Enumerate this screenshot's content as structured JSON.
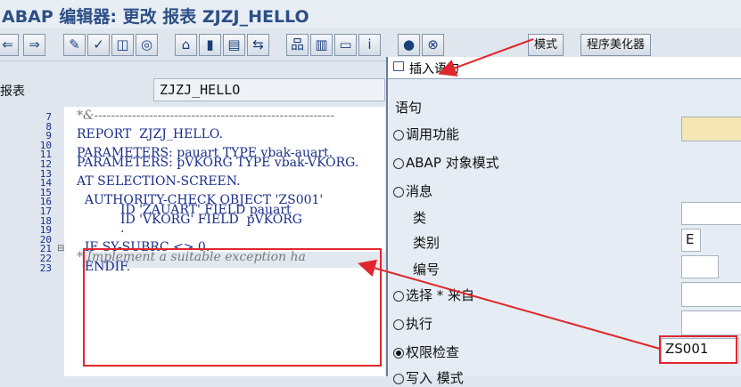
{
  "window": {
    "title": "ABAP 编辑器: 更改 报表 ZJZJ_HELLO"
  },
  "toolbar": {
    "icons": [
      "back-arrow-icon",
      "forward-arrow-icon",
      "other-object-icon",
      "check-icon",
      "activate-icon",
      "test-icon",
      "where-used-icon",
      "object-list-icon",
      "navigation-window-icon",
      "display-object-list-icon",
      "enhance-icon",
      "help-icon",
      "breakpoint-icon",
      "session-breakpoint-icon"
    ],
    "pattern_label": "模式",
    "pretty_printer_label": "程序美化器"
  },
  "editor": {
    "report_label": "报表",
    "report_name": "ZJZJ_HELLO",
    "lines": [
      {
        "no": "7",
        "text": "*&---------------------------------------------------------",
        "kind": "comment"
      },
      {
        "no": "8",
        "text": "",
        "kind": "code"
      },
      {
        "no": "9",
        "text": "REPORT  ZJZJ_HELLO.",
        "kind": "code"
      },
      {
        "no": "10",
        "text": "",
        "kind": "code"
      },
      {
        "no": "11",
        "text": "PARAMETERS: pauart TYPE vbak-auart.",
        "kind": "code"
      },
      {
        "no": "12",
        "text": "PARAMETERS: pVKORG TYPE vbak-VKORG.",
        "kind": "code"
      },
      {
        "no": "13",
        "text": "",
        "kind": "code"
      },
      {
        "no": "14",
        "text": "AT SELECTION-SCREEN.",
        "kind": "code"
      },
      {
        "no": "15",
        "text": "",
        "kind": "code"
      },
      {
        "no": "16",
        "text": "  AUTHORITY-CHECK OBJECT 'ZS001'",
        "kind": "code"
      },
      {
        "no": "17",
        "text": "           ID 'ZAUART' FIELD pauart",
        "kind": "code"
      },
      {
        "no": "18",
        "text": "           ID 'VKORG' FIELD  pVKORG",
        "kind": "code"
      },
      {
        "no": "19",
        "text": "           .",
        "kind": "code"
      },
      {
        "no": "20",
        "text": "",
        "kind": "code"
      },
      {
        "no": "21",
        "text": "  IF SY-SUBRC <> 0.",
        "kind": "code"
      },
      {
        "no": "22",
        "text": "* Implement a suitable exception ha",
        "kind": "comment"
      },
      {
        "no": "23",
        "text": "  ENDIF.",
        "kind": "code"
      }
    ]
  },
  "dialog": {
    "title": "插入语句",
    "section_label": "语句",
    "options": [
      {
        "label": "调用功能",
        "selected": false
      },
      {
        "label": "ABAP 对象模式",
        "selected": false
      },
      {
        "label": "消息",
        "selected": false
      },
      {
        "label": "选择 * 来自",
        "selected": false
      },
      {
        "label": "执行",
        "selected": false
      },
      {
        "label": "权限检查",
        "selected": true
      },
      {
        "label": "写入 模式",
        "selected": false
      }
    ],
    "message_fields": {
      "class_label": "类",
      "type_label": "类别",
      "type_value": "E",
      "number_label": "编号"
    },
    "auth_object_value": "ZS001"
  },
  "colors": {
    "annotation": "#e0262b",
    "title": "#2c4f86"
  }
}
